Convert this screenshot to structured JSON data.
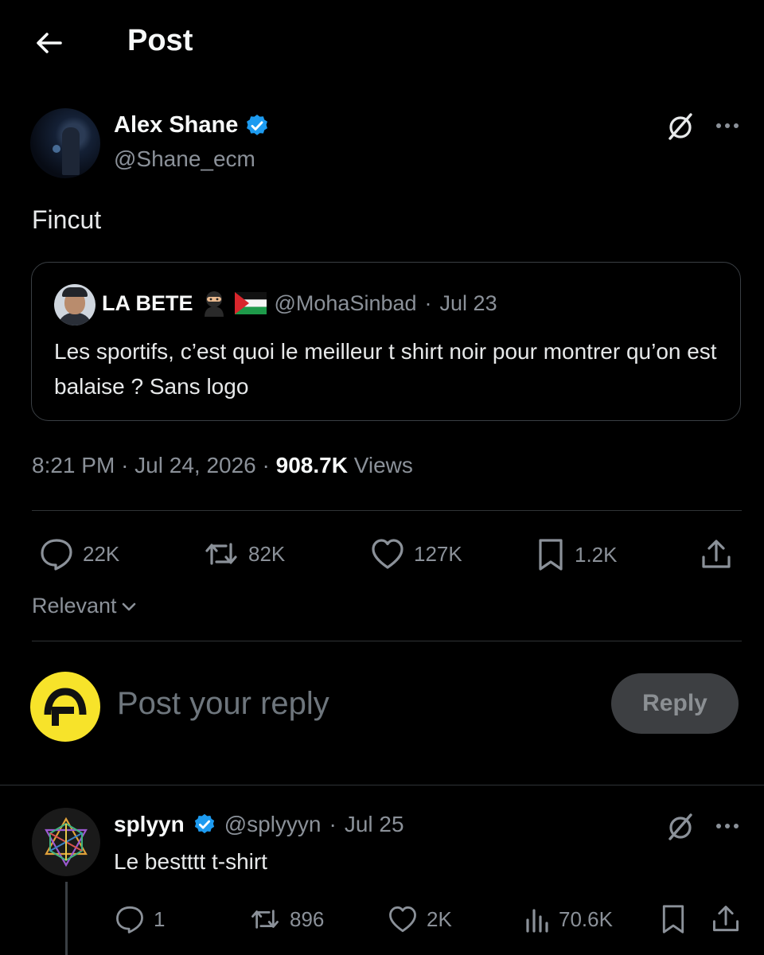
{
  "header": {
    "back_icon": "arrow-left-icon",
    "title": "Post"
  },
  "post": {
    "author": {
      "name": "Alex Shane",
      "handle": "@Shane_ecm",
      "verified": true
    },
    "text": "Fincut",
    "quoted": {
      "name": "LA BETE",
      "name_emojis": [
        "ninja-emoji",
        "palestine-flag-emoji"
      ],
      "handle": "@MohaSinbad",
      "date": "Jul 23",
      "separator": "·",
      "text": "Les sportifs, c’est quoi le meilleur t shirt noir pour montrer qu’on est balaise ? Sans logo"
    },
    "time": "8:21 PM",
    "date": "Jul 24, 2026",
    "views_count": "908.7K",
    "views_label": "Views",
    "stats": {
      "replies": "22K",
      "reposts": "82K",
      "likes": "127K",
      "bookmarks": "1.2K"
    }
  },
  "sort": {
    "label": "Relevant"
  },
  "composer": {
    "placeholder": "Post your reply",
    "button_label": "Reply"
  },
  "reply": {
    "name": "splyyn",
    "handle": "@splyyyn",
    "date": "Jul 25",
    "separator": "·",
    "verified": true,
    "text": "Le bestttt t-shirt",
    "stats": {
      "replies": "1",
      "reposts": "896",
      "likes": "2K",
      "views": "70.6K"
    }
  },
  "colors": {
    "background": "#000000",
    "verified": "#1d9bf0",
    "muted": "#8b9199",
    "avatar_yellow": "#f7e32a"
  }
}
